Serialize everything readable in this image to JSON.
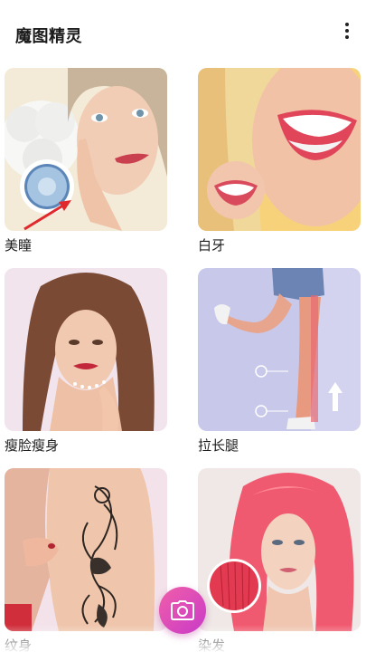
{
  "app": {
    "title": "魔图精灵"
  },
  "menu_icon": "more-vertical-icon",
  "features": [
    {
      "label": "美瞳"
    },
    {
      "label": "白牙"
    },
    {
      "label": "瘦脸瘦身"
    },
    {
      "label": "拉长腿"
    },
    {
      "label": "纹身"
    },
    {
      "label": "染发"
    }
  ],
  "camera_button": {
    "icon": "camera-icon"
  },
  "colors": {
    "accent_start": "#f05fa8",
    "accent_end": "#c93ac8",
    "annotation_arrow": "#e0282d"
  }
}
